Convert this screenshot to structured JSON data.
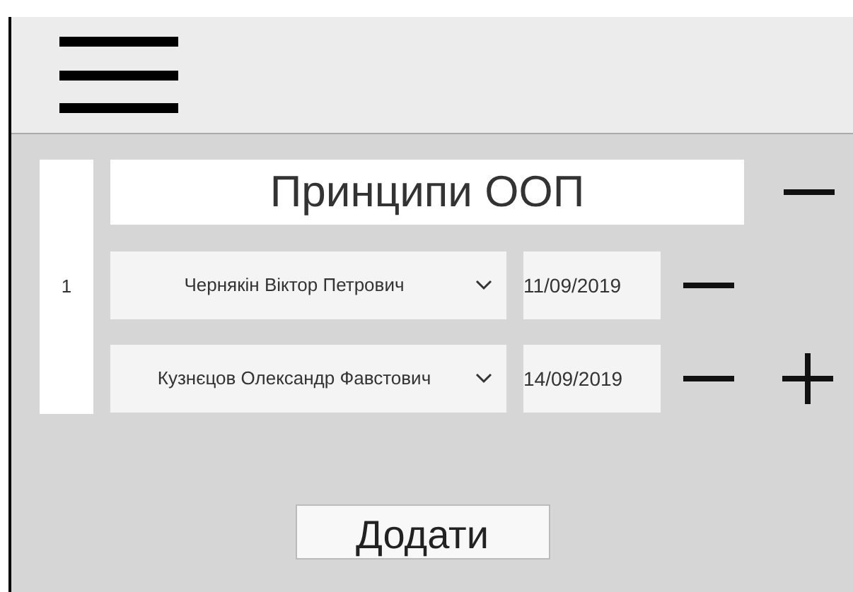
{
  "course": {
    "title": "Принципи ООП",
    "number": "1",
    "lecturers": [
      {
        "name": "Чернякін Віктор Петрович",
        "date": "11/09/2019"
      },
      {
        "name": "Кузнєцов Олександр Фавстович",
        "date": "14/09/2019"
      }
    ]
  },
  "add_button": "Додати"
}
